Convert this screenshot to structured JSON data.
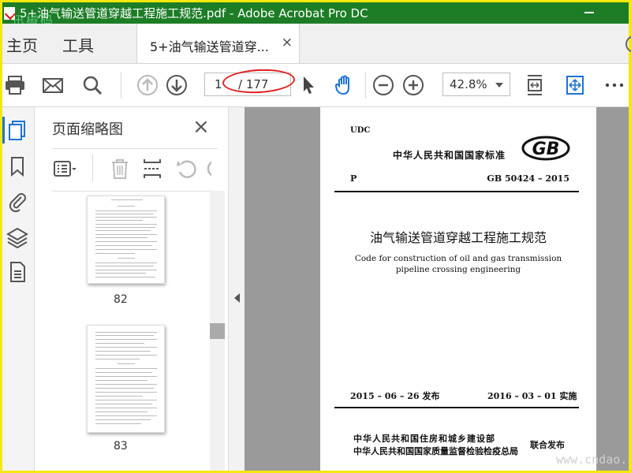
{
  "window": {
    "title": "5+油气输送管道穿越工程施工规范.pdf - Adobe Acrobat Pro DC",
    "title_display": "5+油气输送管道穿越工程施工规范.pdf - Adobe Acrobat Pro DC",
    "watermark": "迅椒码"
  },
  "tabs": {
    "home": "主页",
    "tools": "工具",
    "document": "5+油气输送管道穿...",
    "close": "×"
  },
  "toolbar": {
    "current_page": "1",
    "total_pages": "/ 177",
    "zoom": "42.8%"
  },
  "thumbnail_panel": {
    "title": "页面缩略图",
    "close": "×",
    "thumbnails": [
      {
        "label": "82"
      },
      {
        "label": "83"
      }
    ]
  },
  "document_page": {
    "udc": "UDC",
    "standard": "中华人民共和国国家标准",
    "p_label": "P",
    "standard_number": "GB 50424 – 2015",
    "title_cn": "油气输送管道穿越工程施工规范",
    "title_en_line1": "Code for construction of oil and gas transmission",
    "title_en_line2": "pipeline crossing engineering",
    "issue": "2015 – 06 – 26  发布",
    "effective": "2016 – 03 – 01  实施",
    "org1": "中华人民共和国住房和城乡建设部",
    "org2": "中华人民共和国国家质量监督检验检疫总局",
    "joint": "联合发布"
  },
  "watermark_site": "www.cndao."
}
